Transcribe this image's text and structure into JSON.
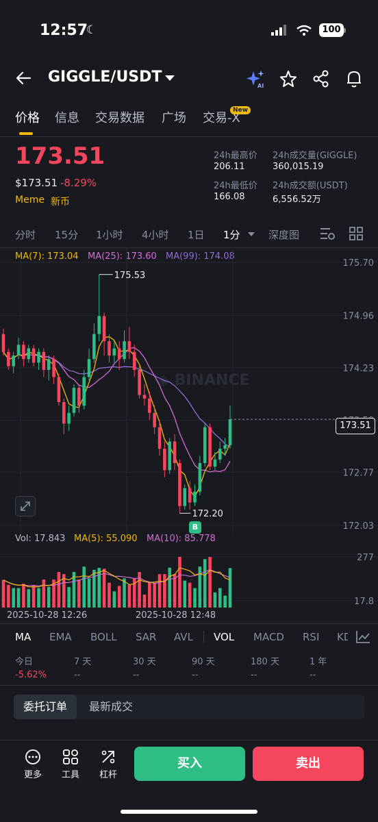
{
  "status": {
    "time": "12:57",
    "battery": "100"
  },
  "header": {
    "title": "GIGGLE/USDT"
  },
  "tabs": [
    {
      "label": "价格"
    },
    {
      "label": "信息"
    },
    {
      "label": "交易数据"
    },
    {
      "label": "广场"
    },
    {
      "label": "交易-X",
      "badge": "New"
    }
  ],
  "price": {
    "last": "173.51",
    "usd": "$173.51",
    "change": "-8.29%",
    "tags": [
      "Meme",
      "新币"
    ]
  },
  "stats": [
    {
      "label": "24h最高价",
      "value": "206.11"
    },
    {
      "label": "24h成交量(GIGGLE)",
      "value": "360,015.19"
    },
    {
      "label": "24h最低价",
      "value": "166.08"
    },
    {
      "label": "24h成交额(USDT)",
      "value": "6,556.52万"
    }
  ],
  "timeframes": [
    "分时",
    "15分",
    "1小时",
    "4小时",
    "1日",
    "1分",
    "深度图"
  ],
  "ma": {
    "ma7": "MA(7): 173.04",
    "ma25": "MA(25): 173.60",
    "ma99": "MA(99): 174.08"
  },
  "chart_data": {
    "type": "candlestick",
    "pair": "GIGGLE/USDT",
    "interval": "1分",
    "y_ticks": [
      175.7,
      174.96,
      174.23,
      173.5,
      172.77,
      172.03
    ],
    "ylim": [
      172.03,
      175.7
    ],
    "current_price": 173.51,
    "high_annotation": 175.53,
    "low_annotation": 172.2,
    "x_labels": [
      "2025-10-28 12:26",
      "2025-10-28 12:48"
    ],
    "candles": [
      [
        174.7,
        174.45,
        174.78,
        174.4
      ],
      [
        174.45,
        174.25,
        174.5,
        174.2
      ],
      [
        174.25,
        174.4,
        174.45,
        174.15
      ],
      [
        174.4,
        174.55,
        174.65,
        174.35
      ],
      [
        174.55,
        174.35,
        174.6,
        174.25
      ],
      [
        174.35,
        174.5,
        174.55,
        174.3
      ],
      [
        174.5,
        174.3,
        174.55,
        174.25
      ],
      [
        174.3,
        174.45,
        174.5,
        174.2
      ],
      [
        174.45,
        174.2,
        174.5,
        174.1
      ],
      [
        174.2,
        174.35,
        174.4,
        174.05
      ],
      [
        174.35,
        174.1,
        174.4,
        174.0
      ],
      [
        174.1,
        173.75,
        174.15,
        173.7
      ],
      [
        173.75,
        173.45,
        173.8,
        173.3
      ],
      [
        173.45,
        173.6,
        173.7,
        173.35
      ],
      [
        173.6,
        173.95,
        174.0,
        173.55
      ],
      [
        173.95,
        173.7,
        174.0,
        173.6
      ],
      [
        173.7,
        174.1,
        174.2,
        173.65
      ],
      [
        174.1,
        174.35,
        174.5,
        174.05
      ],
      [
        174.35,
        174.7,
        174.85,
        174.3
      ],
      [
        174.7,
        174.95,
        175.53,
        174.6
      ],
      [
        174.95,
        174.6,
        175.0,
        174.4
      ],
      [
        174.6,
        174.4,
        174.7,
        174.3
      ],
      [
        174.4,
        174.5,
        174.6,
        174.3
      ],
      [
        174.5,
        174.35,
        174.6,
        174.2
      ],
      [
        174.35,
        174.6,
        174.75,
        174.3
      ],
      [
        174.6,
        174.45,
        174.8,
        174.35
      ],
      [
        174.45,
        174.2,
        174.55,
        174.1
      ],
      [
        174.2,
        173.85,
        174.25,
        173.8
      ],
      [
        173.85,
        173.8,
        174.0,
        173.7
      ],
      [
        173.8,
        173.6,
        173.9,
        173.5
      ],
      [
        173.6,
        173.4,
        173.7,
        173.3
      ],
      [
        173.4,
        173.1,
        173.5,
        173.0
      ],
      [
        173.1,
        172.8,
        173.2,
        172.7
      ],
      [
        172.8,
        173.2,
        173.25,
        172.75
      ],
      [
        173.2,
        172.9,
        173.3,
        172.8
      ],
      [
        172.9,
        172.3,
        172.95,
        172.2
      ],
      [
        172.3,
        172.55,
        172.6,
        172.25
      ],
      [
        172.55,
        172.35,
        172.65,
        172.25
      ],
      [
        172.35,
        172.5,
        172.6,
        172.3
      ],
      [
        172.5,
        172.9,
        173.0,
        172.45
      ],
      [
        172.9,
        173.4,
        173.45,
        172.85
      ],
      [
        173.4,
        172.85,
        173.45,
        172.8
      ],
      [
        172.85,
        172.95,
        173.05,
        172.8
      ],
      [
        172.95,
        173.1,
        173.2,
        172.9
      ],
      [
        173.1,
        173.15,
        173.25,
        173.0
      ],
      [
        173.15,
        173.51,
        173.7,
        173.1
      ]
    ],
    "volume": {
      "label": "Vol: 17.843",
      "ma5": "MA(5): 55.090",
      "ma10": "MA(10): 85.778",
      "y_ticks": [
        277,
        17.8
      ]
    }
  },
  "indicators": [
    "MA",
    "EMA",
    "BOLL",
    "SAR",
    "AVL",
    "VOL",
    "MACD",
    "RSI",
    "KD"
  ],
  "performance": [
    {
      "label": "今日",
      "value": "-5.62%"
    },
    {
      "label": "7 天",
      "value": "--"
    },
    {
      "label": "30 天",
      "value": "--"
    },
    {
      "label": "90 天",
      "value": "--"
    },
    {
      "label": "180 天",
      "value": "--"
    },
    {
      "label": "1 年",
      "value": "--"
    }
  ],
  "orders": {
    "tab_active": "委托订单",
    "tab_other": "最新成交"
  },
  "toolbar": [
    {
      "label": "更多"
    },
    {
      "label": "工具"
    },
    {
      "label": "杠杆"
    }
  ],
  "actions": {
    "buy": "买入",
    "sell": "卖出"
  },
  "colors": {
    "up": "#2ebd85",
    "down": "#f6465d",
    "ma7": "#f0b90b",
    "ma25": "#d66bd6",
    "ma99": "#8e6bd6"
  }
}
